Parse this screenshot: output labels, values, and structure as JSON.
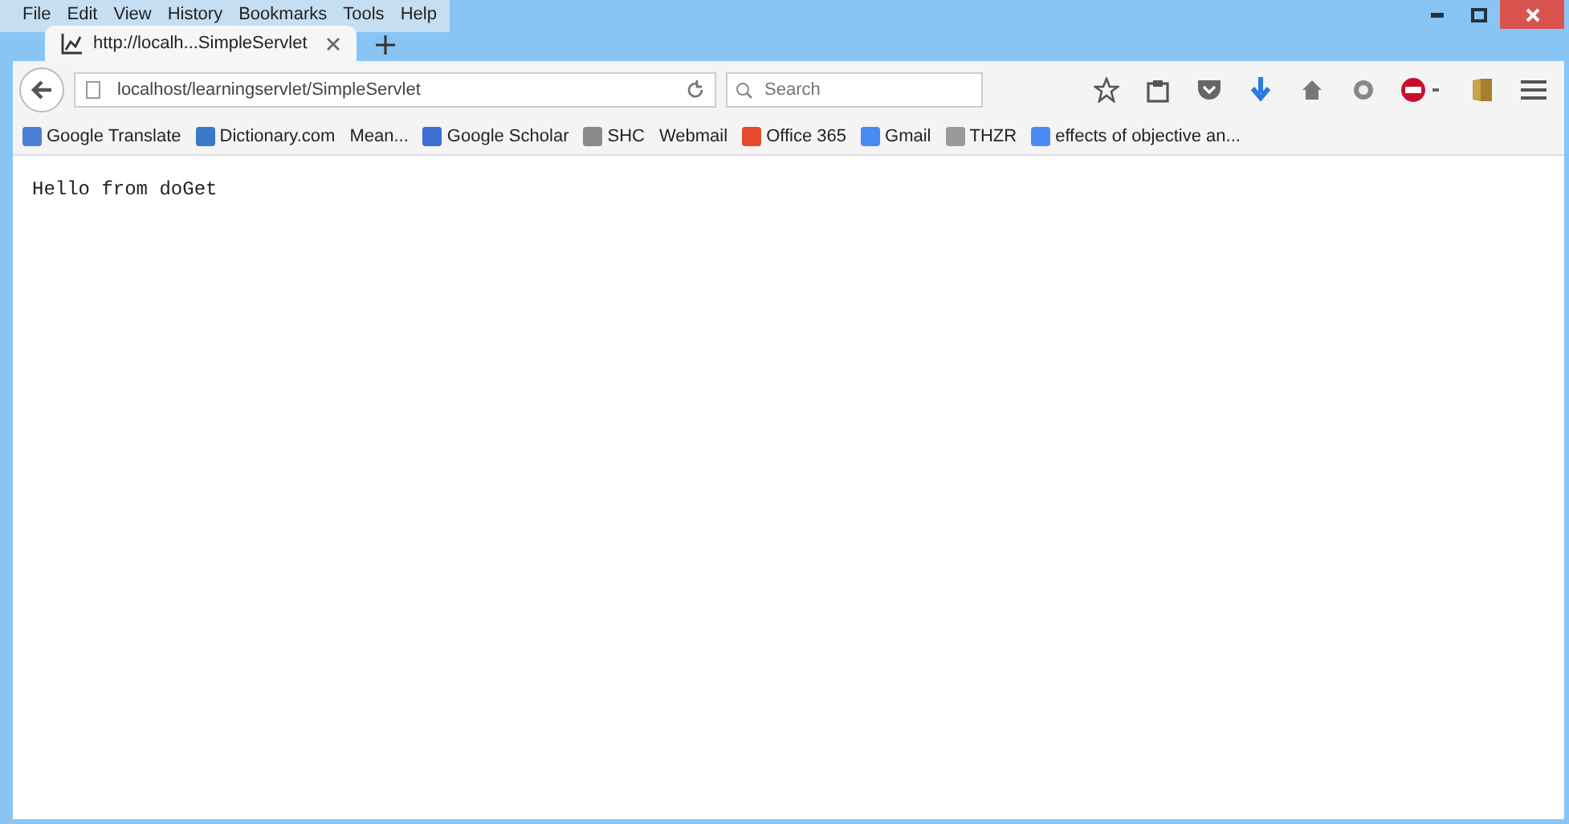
{
  "menu": [
    "File",
    "Edit",
    "View",
    "History",
    "Bookmarks",
    "Tools",
    "Help"
  ],
  "tabs": [
    {
      "title": "http://localh...SimpleServlet",
      "selected": true
    }
  ],
  "address": {
    "value": "localhost/learningservlet/SimpleServlet"
  },
  "search": {
    "placeholder": "Search"
  },
  "bookmarks": [
    {
      "label": "Google Translate",
      "color": "#4a7fd6"
    },
    {
      "label": "Dictionary.com",
      "color": "#3a78c9"
    },
    {
      "label": "Mean..."
    },
    {
      "label": "Google Scholar",
      "color": "#3b6fd0"
    },
    {
      "label": "SHC",
      "color": "#8a8a8a"
    },
    {
      "label": "Webmail"
    },
    {
      "label": "Office 365",
      "color": "#e6492d"
    },
    {
      "label": "Gmail",
      "color": "#4a8af4"
    },
    {
      "label": "THZR",
      "color": "#999999"
    },
    {
      "label": "effects of objective an...",
      "color": "#4a8af4"
    }
  ],
  "page": {
    "text": "Hello from doGet"
  }
}
